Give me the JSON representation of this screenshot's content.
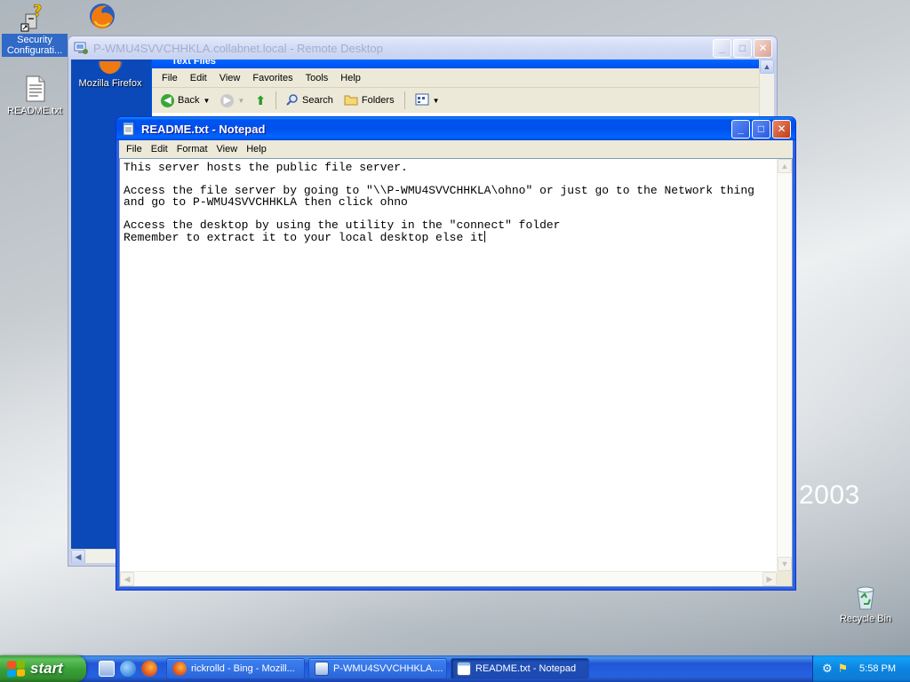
{
  "desktop": {
    "icons": [
      {
        "label": "Security Configurati...",
        "icon": "security-config-icon"
      },
      {
        "label": "README.txt",
        "icon": "text-file-icon"
      },
      {
        "label": "Recycle Bin",
        "icon": "recycle-bin-icon"
      },
      {
        "label": "",
        "icon": "firefox-icon"
      }
    ],
    "wallpaper_text": "2003"
  },
  "rdp_window": {
    "title": "P-WMU4SVVCHHKLA.collabnet.local - Remote Desktop",
    "remote_desktop_icon_label": "Mozilla Firefox",
    "explorer": {
      "title": "Text Files",
      "menu": [
        "File",
        "Edit",
        "View",
        "Favorites",
        "Tools",
        "Help"
      ],
      "toolbar": {
        "back": "Back",
        "search": "Search",
        "folders": "Folders"
      }
    }
  },
  "notepad": {
    "title": "README.txt - Notepad",
    "menu": [
      "File",
      "Edit",
      "Format",
      "View",
      "Help"
    ],
    "content": "This server hosts the public file server.\n\nAccess the file server by going to \"\\\\P-WMU4SVVCHHKLA\\ohno\" or just go to the Network thing\nand go to P-WMU4SVVCHHKLA then click ohno\n\nAccess the desktop by using the utility in the \"connect\" folder\nRemember to extract it to your local desktop else it"
  },
  "taskbar": {
    "start_label": "start",
    "tasks": [
      {
        "label": "rickrolld - Bing - Mozill...",
        "icon": "firefox-icon",
        "active": false
      },
      {
        "label": "P-WMU4SVVCHHKLA....",
        "icon": "remote-desktop-icon",
        "active": false
      },
      {
        "label": "README.txt - Notepad",
        "icon": "notepad-icon",
        "active": true
      }
    ],
    "clock": "5:58 PM"
  },
  "colors": {
    "xp_blue": "#0050ee",
    "start_green": "#3ba23a",
    "tray_blue": "#0c84e0"
  }
}
